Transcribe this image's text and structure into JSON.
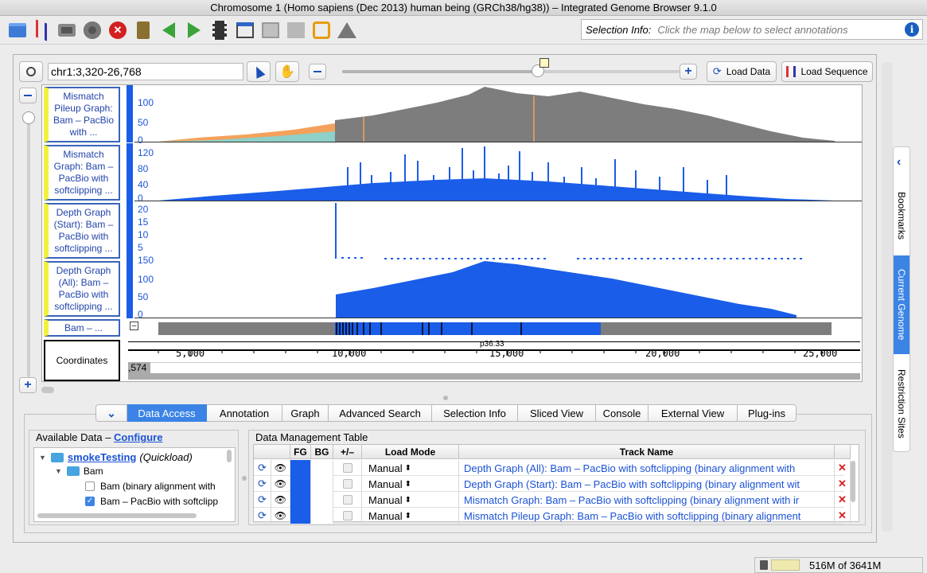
{
  "window": {
    "title": "Chromosome 1  (Homo sapiens (Dec 2013) human being (GRCh38/hg38)) – Integrated Genome Browser 9.1.0"
  },
  "selection_info": {
    "label": "Selection Info:",
    "placeholder": "Click the map below to select annotations"
  },
  "nav": {
    "location": "chr1:3,320-26,768",
    "zoom_level": 0.58,
    "load_data": "Load Data",
    "load_sequence": "Load Sequence"
  },
  "tracks": [
    {
      "label": "Mismatch Pileup Graph: Bam – PacBio with ...",
      "ticks": [
        "100",
        "50",
        "0"
      ]
    },
    {
      "label": "Mismatch Graph: Bam – PacBio with softclipping ...",
      "ticks": [
        "120",
        "80",
        "40",
        "0"
      ]
    },
    {
      "label": "Depth Graph (Start): Bam – PacBio with softclipping ...",
      "ticks": [
        "20",
        "15",
        "10",
        "5"
      ]
    },
    {
      "label": "Depth Graph (All): Bam – PacBio with softclipping ...",
      "ticks": [
        "150",
        "100",
        "50",
        "0"
      ]
    },
    {
      "label": "Bam – ..."
    },
    {
      "label": "Coordinates"
    }
  ],
  "ruler": {
    "band": "p36.33",
    "ticks": [
      "5,000",
      "10,000",
      "15,000",
      "20,000",
      "25,000"
    ],
    "left_value": ",574"
  },
  "side_tabs": [
    "Bookmarks",
    "Current Genome",
    "Restriction Sites"
  ],
  "bottom_tabs": [
    "Data Access",
    "Annotation",
    "Graph",
    "Advanced Search",
    "Selection Info",
    "Sliced View",
    "Console",
    "External View",
    "Plug-ins"
  ],
  "available_data": {
    "title": "Available Data – ",
    "configure": "Configure",
    "items": [
      {
        "name": "smokeTesting",
        "suffix": "(Quickload)"
      },
      {
        "name": "Bam"
      },
      {
        "name": "Bam (binary alignment with"
      },
      {
        "name": "Bam – PacBio with softclipp"
      }
    ]
  },
  "data_management": {
    "title": "Data Management Table",
    "columns": [
      "FG",
      "BG",
      "+/–",
      "Load Mode",
      "Track Name"
    ],
    "rows": [
      {
        "mode": "Manual",
        "name": "Depth Graph (All): Bam – PacBio with softclipping (binary alignment with"
      },
      {
        "mode": "Manual",
        "name": "Depth Graph (Start): Bam – PacBio with softclipping (binary alignment wit"
      },
      {
        "mode": "Manual",
        "name": "Mismatch Graph: Bam – PacBio with softclipping (binary alignment with ir"
      },
      {
        "mode": "Manual",
        "name": "Mismatch Pileup Graph: Bam – PacBio with softclipping (binary alignment"
      }
    ]
  },
  "memory": {
    "text": "516M of 3641M"
  },
  "colors": {
    "accent": "#3b84e6",
    "graph_blue": "#1a5de8",
    "coverage_gray": "#7d7d7d",
    "mismatch_orange": "#f4a15c"
  }
}
